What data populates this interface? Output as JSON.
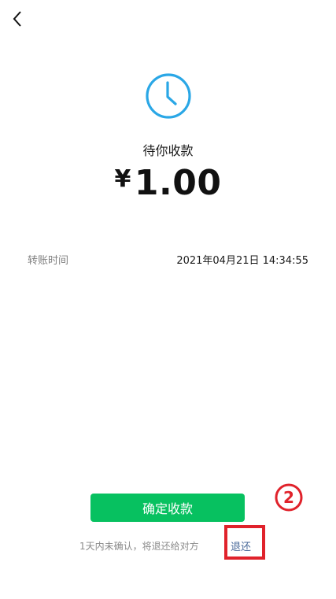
{
  "header": {
    "back_icon": "chevron-left-icon"
  },
  "status": {
    "icon": "clock-icon",
    "icon_color": "#2aa7e6",
    "label": "待你收款"
  },
  "amount": {
    "currency": "¥",
    "value": "1.00"
  },
  "details": {
    "transfer_time_label": "转账时间",
    "transfer_time_value": "2021年04月21日 14:34:55"
  },
  "actions": {
    "confirm_label": "确定收款",
    "confirm_color": "#07c160",
    "note": "1天内未确认，将退还给对方",
    "return_label": "退还"
  },
  "annotation": {
    "step_number": "2",
    "color": "#e0222b"
  }
}
